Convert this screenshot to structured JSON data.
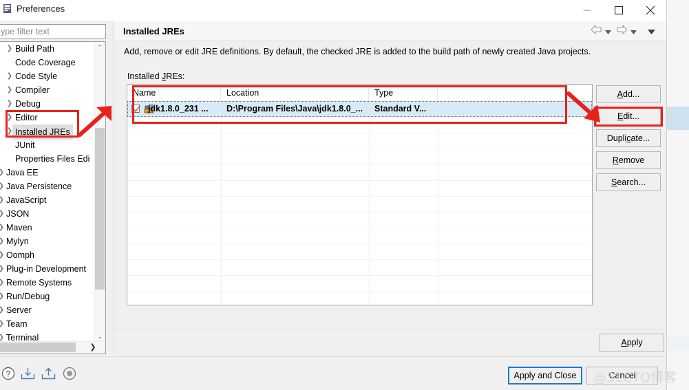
{
  "window": {
    "title": "Preferences",
    "icon": "preferences-icon",
    "minimize_label": "–",
    "maximize_label": "□",
    "close_label": "✕"
  },
  "sidebar": {
    "filter": {
      "value": "ype filter text",
      "placeholder": "type filter text"
    },
    "items": [
      {
        "label": "Build Path",
        "level": 2,
        "expandable": true,
        "selected": false
      },
      {
        "label": "Code Coverage",
        "level": 2,
        "expandable": false,
        "selected": false
      },
      {
        "label": "Code Style",
        "level": 2,
        "expandable": true,
        "selected": false
      },
      {
        "label": "Compiler",
        "level": 2,
        "expandable": true,
        "selected": false
      },
      {
        "label": "Debug",
        "level": 2,
        "expandable": true,
        "selected": false
      },
      {
        "label": "Editor",
        "level": 2,
        "expandable": true,
        "selected": false
      },
      {
        "label": "Installed JREs",
        "level": 2,
        "expandable": true,
        "selected": true
      },
      {
        "label": "JUnit",
        "level": 2,
        "expandable": false,
        "selected": false
      },
      {
        "label": "Properties Files Edi",
        "level": 2,
        "expandable": false,
        "selected": false
      },
      {
        "label": "Java EE",
        "level": 1,
        "expandable": true,
        "selected": false
      },
      {
        "label": "Java Persistence",
        "level": 1,
        "expandable": true,
        "selected": false
      },
      {
        "label": "JavaScript",
        "level": 1,
        "expandable": true,
        "selected": false
      },
      {
        "label": "JSON",
        "level": 1,
        "expandable": true,
        "selected": false
      },
      {
        "label": "Maven",
        "level": 1,
        "expandable": true,
        "selected": false
      },
      {
        "label": "Mylyn",
        "level": 1,
        "expandable": true,
        "selected": false
      },
      {
        "label": "Oomph",
        "level": 1,
        "expandable": true,
        "selected": false
      },
      {
        "label": "Plug-in Development",
        "level": 1,
        "expandable": true,
        "selected": false
      },
      {
        "label": "Remote Systems",
        "level": 1,
        "expandable": true,
        "selected": false
      },
      {
        "label": "Run/Debug",
        "level": 1,
        "expandable": true,
        "selected": false
      },
      {
        "label": "Server",
        "level": 1,
        "expandable": true,
        "selected": false
      },
      {
        "label": "Team",
        "level": 1,
        "expandable": true,
        "selected": false
      },
      {
        "label": "Terminal",
        "level": 1,
        "expandable": true,
        "selected": false
      }
    ],
    "scroll_up_glyph": "⌃",
    "scroll_down_glyph": "⌄",
    "scroll_right_glyph": "❯"
  },
  "page": {
    "title": "Installed JREs",
    "description": "Add, remove or edit JRE definitions. By default, the checked JRE is added to the build path of newly created Java projects.",
    "table_label_pre": "Installed ",
    "table_label_mnemonic": "J",
    "table_label_post": "REs:"
  },
  "nav": {
    "back": "back-arrow",
    "back_menu": "back-dropdown",
    "forward": "forward-arrow",
    "forward_menu": "forward-dropdown",
    "menu": "view-menu-dropdown"
  },
  "table": {
    "columns": [
      "Name",
      "Location",
      "Type",
      ""
    ],
    "rows": [
      {
        "checked": true,
        "icon": "jre-icon",
        "name": "jdk1.8.0_231 ...",
        "location": "D:\\Program Files\\Java\\jdk1.8.0_...",
        "type": "Standard V...",
        "selected": true,
        "bold": true
      }
    ]
  },
  "side_buttons": [
    {
      "pre": "",
      "mnemonic": "A",
      "post": "dd...",
      "name": "add-button",
      "highlighted": false
    },
    {
      "pre": "",
      "mnemonic": "E",
      "post": "dit...",
      "name": "edit-button",
      "highlighted": true
    },
    {
      "pre": "Dupli",
      "mnemonic": "c",
      "post": "ate...",
      "name": "duplicate-button",
      "highlighted": false
    },
    {
      "pre": "",
      "mnemonic": "R",
      "post": "emove",
      "name": "remove-button",
      "highlighted": false
    },
    {
      "pre": "",
      "mnemonic": "S",
      "post": "earch...",
      "name": "search-button",
      "highlighted": false
    }
  ],
  "footer": {
    "apply_pre": "",
    "apply_mnemonic": "A",
    "apply_post": "pply",
    "apply_and_close": "Apply and Close",
    "cancel": "Cancel",
    "icons": [
      "help-icon",
      "import-icon",
      "export-icon",
      "record-preferences-icon"
    ]
  },
  "watermark": {
    "text": "@51CTO博客"
  },
  "annotations": {
    "accent_red": "#e8211a",
    "focus_blue": "#1a7ac7",
    "selection_blue": "#d9eaf7",
    "boxes": [
      "tree-installed-jres-box",
      "table-box",
      "edit-button-box"
    ],
    "arrows": [
      "arrow-to-installed-jres",
      "arrow-to-edit-button"
    ]
  }
}
